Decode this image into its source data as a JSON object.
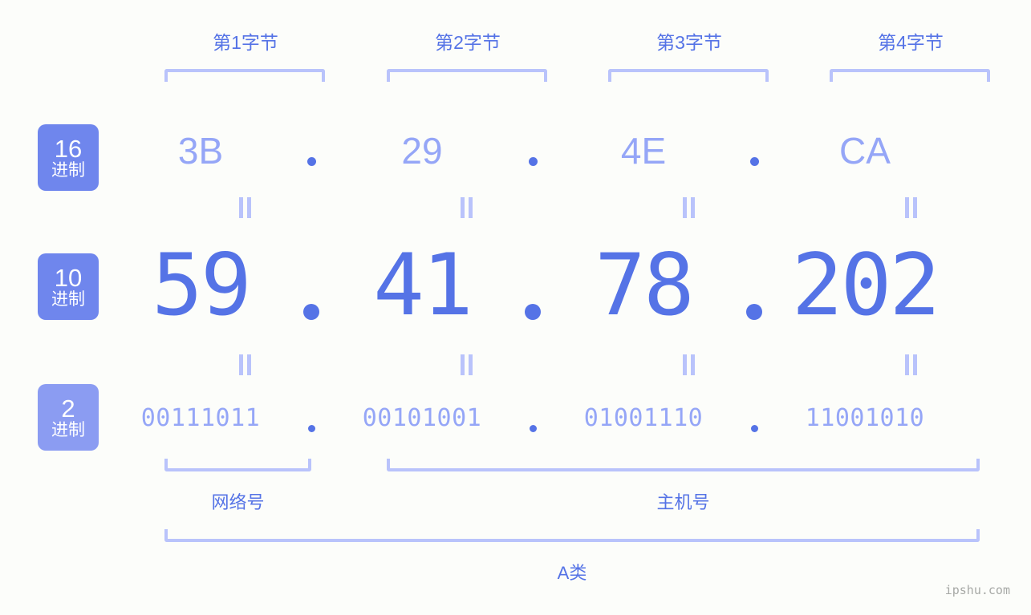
{
  "background_color": "#fcfdfa",
  "accent_color": "#5573e6",
  "accent_light_color": "#95a6f7",
  "bracket_color": "#b9c3fb",
  "badge_color": "#6f86ed",
  "byte_headers": [
    {
      "label": "第1字节"
    },
    {
      "label": "第2字节"
    },
    {
      "label": "第3字节"
    },
    {
      "label": "第4字节"
    }
  ],
  "radix_badges": [
    {
      "number": "16",
      "system": "进制"
    },
    {
      "number": "10",
      "system": "进制"
    },
    {
      "number": "2",
      "system": "进制"
    }
  ],
  "rows": {
    "hex": {
      "values": [
        "3B",
        "29",
        "4E",
        "CA"
      ],
      "separator": "."
    },
    "decimal": {
      "values": [
        "59",
        "41",
        "78",
        "202"
      ],
      "separator": "."
    },
    "binary": {
      "values": [
        "00111011",
        "00101001",
        "01001110",
        "11001010"
      ],
      "separator": "."
    }
  },
  "equals_symbol": "=",
  "sections": [
    {
      "label": "网络号"
    },
    {
      "label": "主机号"
    }
  ],
  "class_label": "A类",
  "watermark": "ipshu.com"
}
